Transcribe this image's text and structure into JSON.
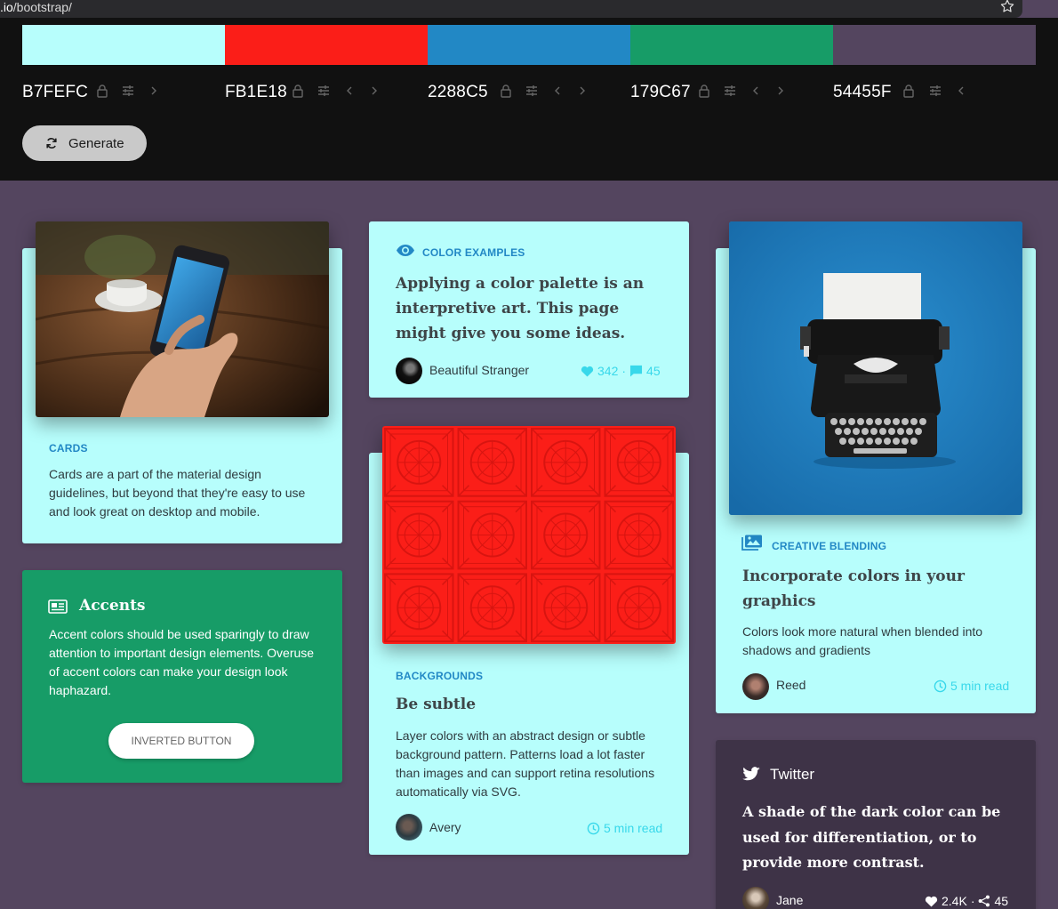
{
  "browser": {
    "url_domain": ".io",
    "url_path": "/bootstrap/",
    "star_icon": "star-outline-icon"
  },
  "palette": {
    "colors": [
      {
        "code": "B7FEFC",
        "hex": "#B7FEFC"
      },
      {
        "code": "FB1E18",
        "hex": "#FB1E18"
      },
      {
        "code": "2288C5",
        "hex": "#2288C5"
      },
      {
        "code": "179C67",
        "hex": "#179C67"
      },
      {
        "code": "54455F",
        "hex": "#54455F"
      }
    ],
    "generate_label": "Generate",
    "generate_icon": "refresh-icon"
  },
  "cards": {
    "cards_card": {
      "eyebrow": "CARDS",
      "body": "Cards are a part of the material design guidelines, but beyond that they're easy to use and look great on desktop and mobile."
    },
    "accents_card": {
      "title": "Accents",
      "icon": "newspaper-icon",
      "body": "Accent colors should be used sparingly to draw attention to important design elements. Overuse of accent colors can make your design look haphazard.",
      "button_label": "INVERTED BUTTON"
    },
    "color_examples_card": {
      "eyebrow": "COLOR EXAMPLES",
      "icon": "eye-icon",
      "heading": "Applying a color palette is an interpretive art. This page might give you some ideas.",
      "author": "Beautiful Stranger",
      "likes": "342",
      "separator": "·",
      "comments": "45"
    },
    "backgrounds_card": {
      "eyebrow": "BACKGROUNDS",
      "heading": "Be subtle",
      "body": "Layer colors with an abstract design or subtle background pattern. Patterns load a lot faster than images and can support retina resolutions automatically via SVG.",
      "author": "Avery",
      "read_time": "5 min read"
    },
    "blending_card": {
      "eyebrow": "CREATIVE BLENDING",
      "icon": "images-icon",
      "heading": "Incorporate colors in your graphics",
      "body": "Colors look more natural when blended into shadows and gradients",
      "author": "Reed",
      "read_time": "5 min read"
    },
    "twitter_card": {
      "title": "Twitter",
      "icon": "twitter-bird-icon",
      "heading": "A shade of the dark color can be used for differentiation, or to provide more contrast.",
      "author": "Jane",
      "likes": "2.4K",
      "separator": "·",
      "shares": "45"
    }
  }
}
